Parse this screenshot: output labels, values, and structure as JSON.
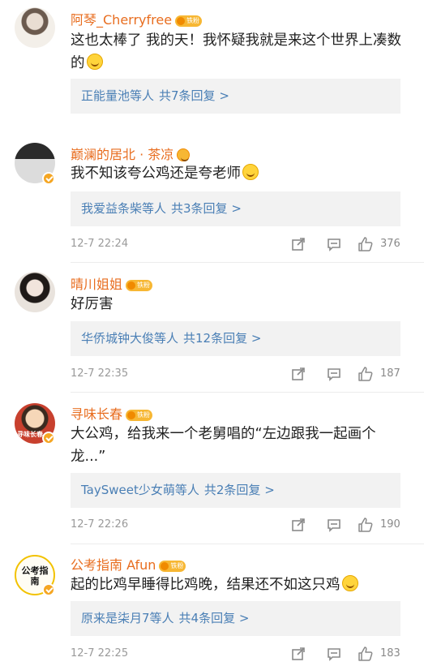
{
  "comments": [
    {
      "username": "阿琴_Cherryfree",
      "badge": "铁粉",
      "text": "这也太棒了 我的天！我怀疑我就是来这个世界上凑数的",
      "emoji": "laugh-emoji",
      "reply_names": "正能量池等人",
      "reply_count": "共7条回复 >",
      "verified": false
    },
    {
      "username": "巅澜的居北 · 茶凉",
      "badge": "",
      "text": "我不知该夸公鸡还是夸老师",
      "emoji": "laugh-cry-emoji",
      "reply_names": "我爱益条柴等人",
      "reply_count": "共3条回复 >",
      "timestamp": "12-7 22:24",
      "likes": "376",
      "verified": true
    },
    {
      "username": "晴川姐姐",
      "badge": "铁粉",
      "text": "好厉害",
      "reply_names": "华侨城钟大俊等人",
      "reply_count": "共12条回复 >",
      "timestamp": "12-7 22:35",
      "likes": "187",
      "verified": false
    },
    {
      "username": "寻味长春",
      "badge": "铁粉",
      "text": "大公鸡，给我来一个老舅唱的“左边跟我一起画个龙...”",
      "reply_names": "TaySweet少女萌等人",
      "reply_count": "共2条回复 >",
      "timestamp": "12-7 22:26",
      "likes": "190",
      "avatar_text": "寻味长春",
      "verified": true
    },
    {
      "username": "公考指南 Afun",
      "badge": "铁粉",
      "text": "起的比鸡早睡得比鸡晚，结果还不如这只鸡",
      "emoji": "laugh-cry-emoji",
      "reply_names": "原来是柒月7等人",
      "reply_count": "共4条回复 >",
      "timestamp": "12-7 22:25",
      "likes": "183",
      "avatar_text": "公考指南",
      "verified": true
    }
  ]
}
